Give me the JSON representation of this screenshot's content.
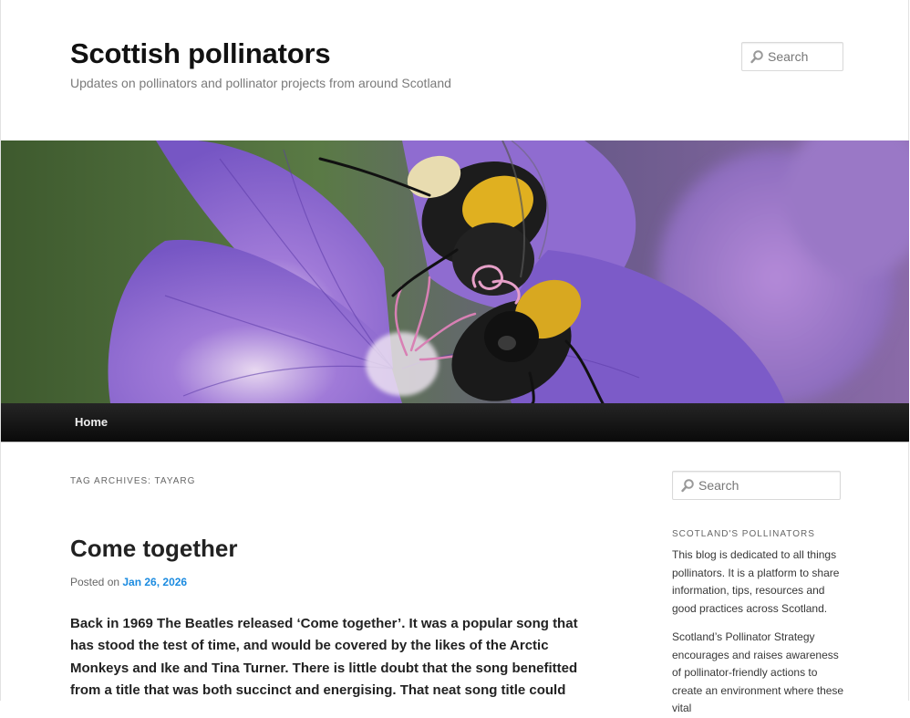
{
  "site": {
    "title": "Scottish pollinators",
    "description": "Updates on pollinators and pollinator projects from around Scotland"
  },
  "header_search": {
    "placeholder": "Search"
  },
  "banner": {
    "image": "bumblebee on purple geranium flower"
  },
  "nav": {
    "items": [
      {
        "label": "Home"
      }
    ]
  },
  "archive": {
    "heading": "TAG ARCHIVES: TAYARG"
  },
  "post": {
    "title": "Come together",
    "posted_on_label": "Posted on ",
    "date": "Jan 26, 2026",
    "excerpt": "Back in 1969 The Beatles released ‘Come together’. It was a popular song that has stood the test of time, and would be covered by the likes of the Arctic Monkeys and Ike and Tina Turner. There is little doubt that the song benefitted from a title that was both succinct and energising. That neat song title could"
  },
  "sidebar": {
    "search_placeholder": "Search",
    "widget_title": "SCOTLAND'S POLLINATORS",
    "paragraph1": "This blog is dedicated to all things pollinators. It is a platform to share information, tips, resources and good practices across Scotland.",
    "paragraph2": "Scotland’s Pollinator Strategy encourages and raises awareness of pollinator-friendly actions to create an environment where these vital"
  },
  "colors": {
    "link": "#1b8be0",
    "nav_bg": "#111111",
    "title": "#111111"
  },
  "icons": {
    "search": "magnifier-icon"
  }
}
